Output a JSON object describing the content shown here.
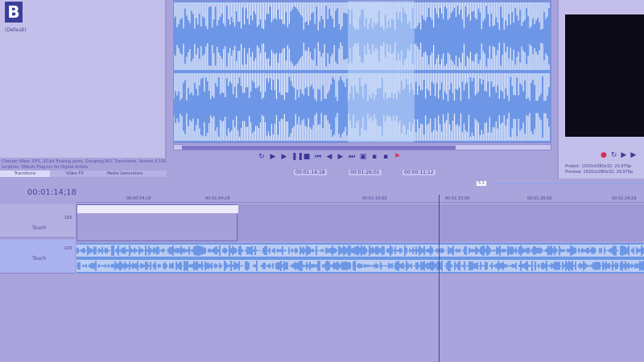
{
  "explorer": {
    "logo": "B",
    "preset": "(Default)",
    "description": [
      "Checker Wipe: OFX, 32-bit floating point, Grouping BCC Transitions, Version 9.100",
      "scription: Effects Plug-ins for Digital Artists"
    ],
    "tabs": [
      "Transitions",
      "Video FX",
      "Media Generators"
    ]
  },
  "trimmer": {
    "in_time": "00:01:14;18",
    "out_time": "00:01:26;01",
    "length": "00:00:11;12"
  },
  "preview": {
    "project": "Project:  1920x1080x32; 29,970p",
    "preview": "Preview:  1920x1080x32; 29,970p"
  },
  "timeline": {
    "cursor_time": "00:01:14;18",
    "zoom_label": "5:1",
    "ruler": [
      "00:00:54;18",
      "00:01:04;28",
      "00:01:10;00",
      "00:01:15;00",
      "00:01:20;00",
      "00:01:24;29"
    ],
    "tracks": [
      {
        "type": "video",
        "label": "Touch",
        "level": "100"
      },
      {
        "type": "audio",
        "label": "Touch",
        "level": "100"
      }
    ]
  },
  "colors": {
    "wave": "#6d97e6",
    "bg": "#a9a3dc"
  }
}
